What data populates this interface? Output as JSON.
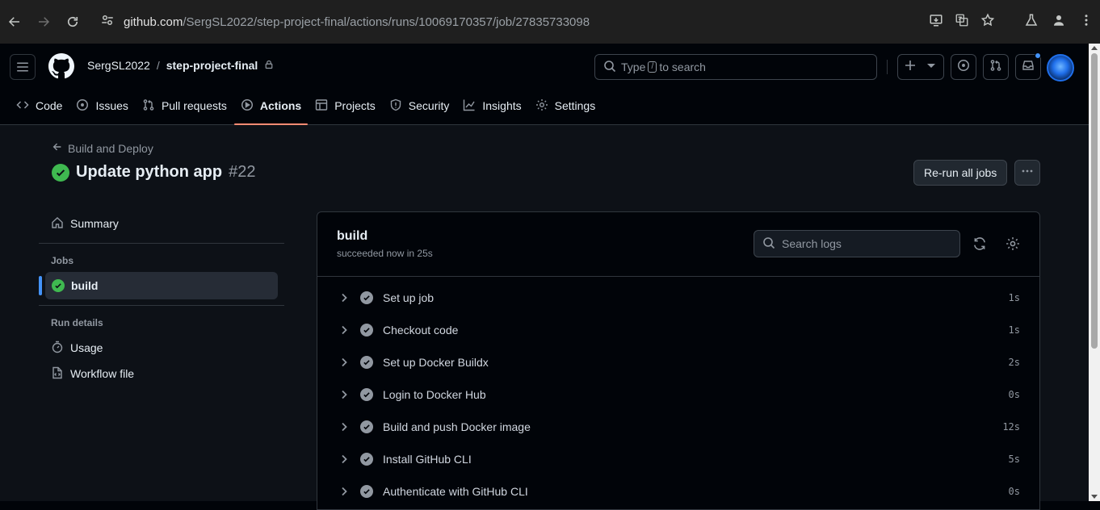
{
  "browser": {
    "url_host": "github.com",
    "url_path": "/SergSL2022/step-project-final/actions/runs/10069170357/job/27835733098"
  },
  "header": {
    "owner": "SergSL2022",
    "separator": "/",
    "repo": "step-project-final",
    "search_prefix": "Type",
    "search_key": "/",
    "search_suffix": "to search"
  },
  "repo_nav": {
    "items": [
      {
        "label": "Code",
        "icon": "code-icon"
      },
      {
        "label": "Issues",
        "icon": "issue-icon"
      },
      {
        "label": "Pull requests",
        "icon": "pull-request-icon"
      },
      {
        "label": "Actions",
        "icon": "play-icon"
      },
      {
        "label": "Projects",
        "icon": "table-icon"
      },
      {
        "label": "Security",
        "icon": "shield-icon"
      },
      {
        "label": "Insights",
        "icon": "graph-icon"
      },
      {
        "label": "Settings",
        "icon": "gear-icon"
      }
    ],
    "active": "Actions"
  },
  "run": {
    "back_label": "Build and Deploy",
    "title": "Update python app",
    "number": "#22",
    "rerun_label": "Re-run all jobs"
  },
  "sidebar": {
    "summary": "Summary",
    "jobs_heading": "Jobs",
    "job": "build",
    "run_details_heading": "Run details",
    "usage": "Usage",
    "workflow_file": "Workflow file"
  },
  "job": {
    "name": "build",
    "status": "succeeded now in 25s",
    "search_placeholder": "Search logs",
    "steps": [
      {
        "name": "Set up job",
        "duration": "1s"
      },
      {
        "name": "Checkout code",
        "duration": "1s"
      },
      {
        "name": "Set up Docker Buildx",
        "duration": "2s"
      },
      {
        "name": "Login to Docker Hub",
        "duration": "0s"
      },
      {
        "name": "Build and push Docker image",
        "duration": "12s"
      },
      {
        "name": "Install GitHub CLI",
        "duration": "5s"
      },
      {
        "name": "Authenticate with GitHub CLI",
        "duration": "0s"
      }
    ]
  },
  "colors": {
    "success": "#3fb950",
    "accent": "#4493f8",
    "active_tab": "#fd8c73"
  }
}
